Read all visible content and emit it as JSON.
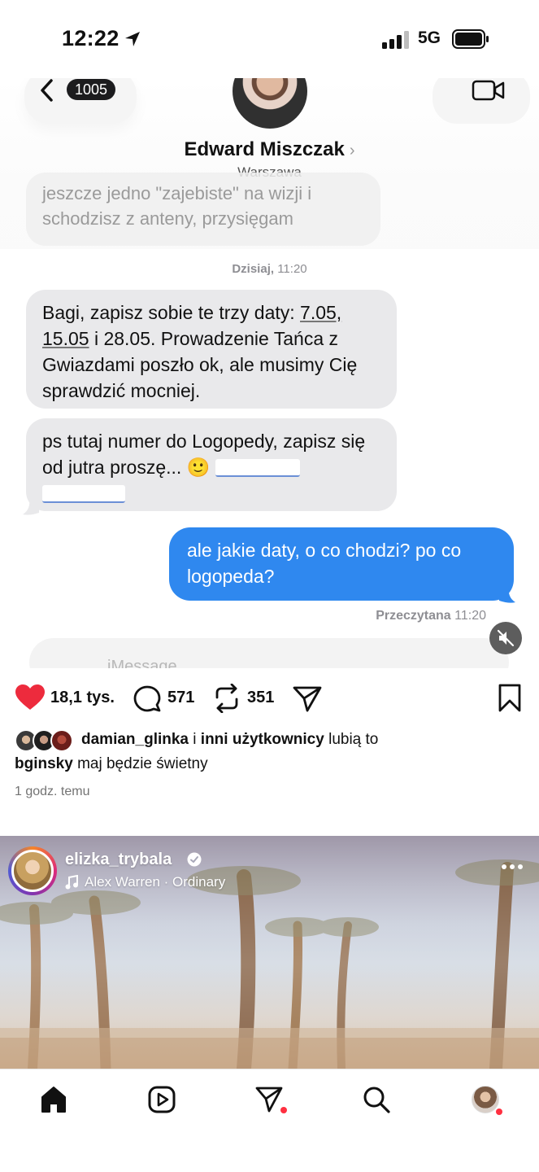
{
  "status_bar": {
    "time": "12:22",
    "network": "5G"
  },
  "chat": {
    "unread_count": "1005",
    "contact_name": "Edward Miszczak",
    "contact_location": "Warszawa",
    "previous_message": "jeszcze jedno \"zajebiste\" na wizji i schodzisz z anteny, przysięgam",
    "day_label": "Dzisiaj,",
    "day_time": "11:20",
    "message_1": {
      "part_a": "Bagi, zapisz sobie te trzy daty: ",
      "date_a": "7.05,",
      "date_b": "15.05",
      "part_b": " i 28.05. Prowadzenie Tańca z Gwiazdami poszło ok, ale musimy Cię sprawdzić mocniej."
    },
    "message_2": "ps tutaj numer do Logopedy, zapisz się od jutra proszę...",
    "message_2_emoji": "🙂",
    "reply": "ale jakie daty, o co chodzi? po co logopeda?",
    "read_label": "Przeczytana",
    "read_time": "11:20",
    "input_placeholder": "iMessage"
  },
  "post": {
    "likes_count": "18,1 tys.",
    "comments_count": "571",
    "reposts_count": "351",
    "liked_by_user": "damian_glinka",
    "liked_by_joiner": "i",
    "liked_by_others": "inni użytkownicy",
    "liked_by_suffix": "lubią to",
    "caption_user": "bginsky",
    "caption_text": "maj będzie świetny",
    "time_ago": "1 godz. temu"
  },
  "next_post": {
    "username": "elizka_trybala",
    "audio": "Alex Warren · Ordinary"
  },
  "colors": {
    "heart": "#ed2b3d",
    "outgoing_bubble": "#2f88ef",
    "incoming_bubble": "#e9e9eb",
    "notification_dot": "#ff3040"
  },
  "icons": {
    "status": [
      "location-arrow-icon",
      "signal-icon",
      "battery-icon"
    ],
    "actions": [
      "heart-icon",
      "comment-icon",
      "repost-icon",
      "send-icon",
      "bookmark-icon"
    ],
    "tabs": [
      "home-icon",
      "reels-icon",
      "messages-icon",
      "search-icon",
      "profile-avatar"
    ]
  }
}
